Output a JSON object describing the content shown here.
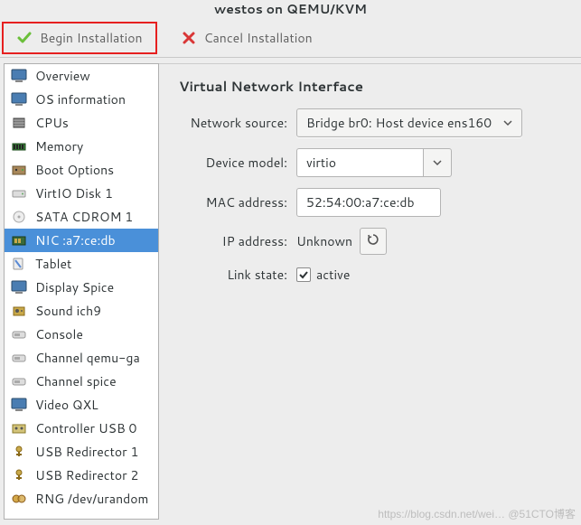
{
  "title": "westos on QEMU/KVM",
  "toolbar": {
    "begin": "Begin Installation",
    "cancel": "Cancel Installation"
  },
  "sidebar": {
    "items": [
      {
        "label": "Overview"
      },
      {
        "label": "OS information"
      },
      {
        "label": "CPUs"
      },
      {
        "label": "Memory"
      },
      {
        "label": "Boot Options"
      },
      {
        "label": "VirtIO Disk 1"
      },
      {
        "label": "SATA CDROM 1"
      },
      {
        "label": "NIC :a7:ce:db"
      },
      {
        "label": "Tablet"
      },
      {
        "label": "Display Spice"
      },
      {
        "label": "Sound ich9"
      },
      {
        "label": "Console"
      },
      {
        "label": "Channel qemu-ga"
      },
      {
        "label": "Channel spice"
      },
      {
        "label": "Video QXL"
      },
      {
        "label": "Controller USB 0"
      },
      {
        "label": "USB Redirector 1"
      },
      {
        "label": "USB Redirector 2"
      },
      {
        "label": "RNG /dev/urandom"
      }
    ],
    "selected_index": 7
  },
  "panel": {
    "heading": "Virtual Network Interface",
    "labels": {
      "source": "Network source:",
      "model": "Device model:",
      "mac": "MAC address:",
      "ip": "IP address:",
      "link": "Link state:"
    },
    "values": {
      "source": "Bridge br0: Host device ens160",
      "model": "virtio",
      "mac": "52:54:00:a7:ce:db",
      "ip": "Unknown",
      "link_active": "active"
    }
  },
  "watermark": "https://blog.csdn.net/wei…  @51CTO博客"
}
